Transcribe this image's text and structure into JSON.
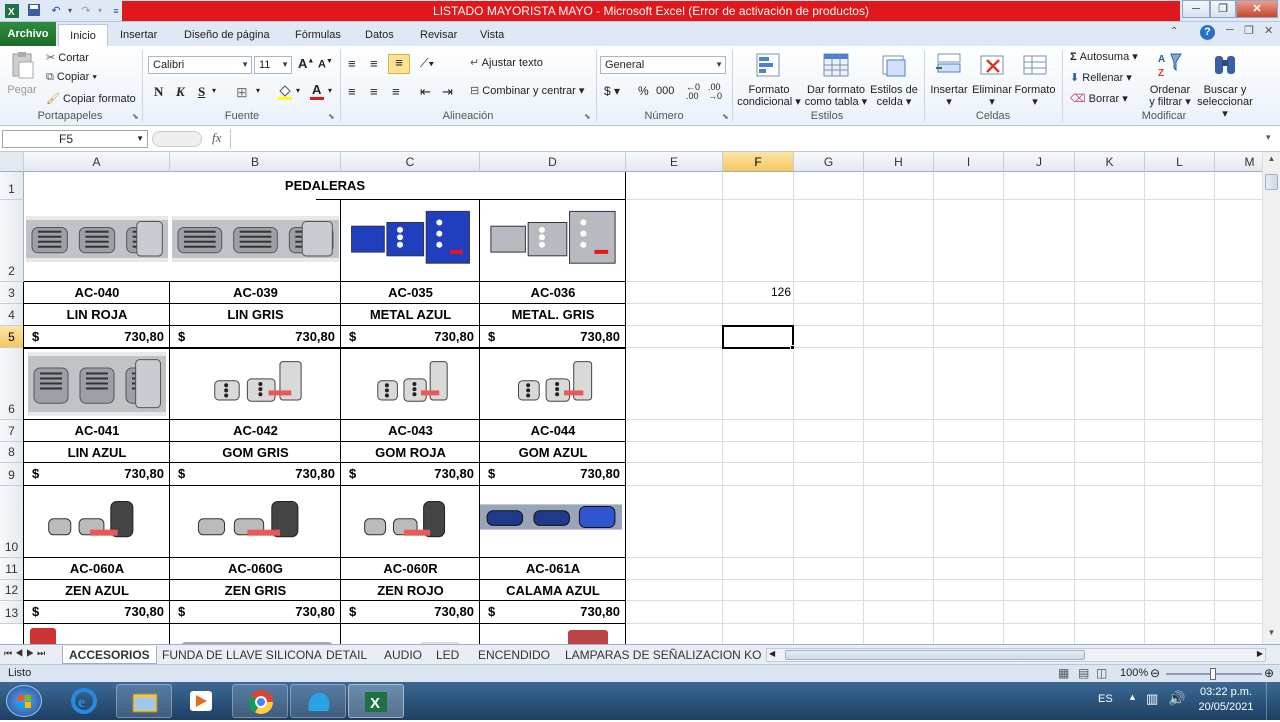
{
  "window": {
    "title": "LISTADO MAYORISTA MAYO  -  Microsoft Excel (Error de activación de productos)",
    "quick_access": [
      "save-icon",
      "undo-icon",
      "redo-icon"
    ]
  },
  "ribbon": {
    "tabs": [
      "Archivo",
      "Inicio",
      "Insertar",
      "Diseño de página",
      "Fórmulas",
      "Datos",
      "Revisar",
      "Vista"
    ],
    "clipboard": {
      "paste": "Pegar",
      "cut": "Cortar",
      "copy": "Copiar",
      "format_painter": "Copiar formato",
      "label": "Portapapeles"
    },
    "font": {
      "name": "Calibri",
      "size": "11",
      "bold": "N",
      "italic": "K",
      "underline": "S",
      "label": "Fuente"
    },
    "alignment": {
      "wrap": "Ajustar texto",
      "merge": "Combinar y centrar",
      "label": "Alineación"
    },
    "number": {
      "format": "General",
      "currency": "$",
      "percent": "%",
      "thousands": "000",
      "label": "Número"
    },
    "styles": {
      "conditional_1": "Formato",
      "conditional_2": "condicional",
      "table_1": "Dar formato",
      "table_2": "como tabla",
      "cell_1": "Estilos de",
      "cell_2": "celda",
      "label": "Estilos"
    },
    "cells": {
      "insert": "Insertar",
      "delete": "Eliminar",
      "format": "Formato",
      "label": "Celdas"
    },
    "editing": {
      "autosum": "Autosuma",
      "fill": "Rellenar",
      "clear": "Borrar",
      "sort_1": "Ordenar",
      "sort_2": "y filtrar",
      "find_1": "Buscar y",
      "find_2": "seleccionar",
      "label": "Modificar"
    }
  },
  "formula_bar": {
    "name_box": "F5",
    "fx": "fx",
    "value": ""
  },
  "columns": [
    "A",
    "B",
    "C",
    "D",
    "E",
    "F",
    "G",
    "H",
    "I",
    "J",
    "K",
    "L",
    "M"
  ],
  "rows": [
    "1",
    "2",
    "3",
    "4",
    "5",
    "6",
    "7",
    "8",
    "9",
    "10",
    "11",
    "12",
    "13"
  ],
  "selected_cell": "F5",
  "sheet": {
    "header": "PEDALERAS",
    "f3_value": "126",
    "currency": "$",
    "blocks": [
      {
        "codes": [
          "AC-040",
          "AC-039",
          "AC-035",
          "AC-036"
        ],
        "names": [
          "LIN ROJA",
          "LIN GRIS",
          "METAL AZUL",
          "METAL. GRIS"
        ],
        "prices": [
          "730,80",
          "730,80",
          "730,80",
          "730,80"
        ]
      },
      {
        "codes": [
          "AC-041",
          "AC-042",
          "AC-043",
          "AC-044"
        ],
        "names": [
          "LIN AZUL",
          "GOM GRIS",
          "GOM ROJA",
          "GOM AZUL"
        ],
        "prices": [
          "730,80",
          "730,80",
          "730,80",
          "730,80"
        ]
      },
      {
        "codes": [
          "AC-060A",
          "AC-060G",
          "AC-060R",
          "AC-061A"
        ],
        "names": [
          "ZEN AZUL",
          "ZEN GRIS",
          "ZEN ROJO",
          "CALAMA AZUL"
        ],
        "prices": [
          "730,80",
          "730,80",
          "730,80",
          "730,80"
        ]
      }
    ]
  },
  "sheet_tabs": [
    "ACCESORIOS",
    "FUNDA DE LLAVE SILICONA",
    "DETAIL",
    "AUDIO",
    "LED",
    "ENCENDIDO",
    "LAMPARAS DE SEÑALIZACION KOBO"
  ],
  "status": {
    "ready": "Listo",
    "zoom": "100%"
  },
  "taskbar": {
    "lang": "ES",
    "time": "03:22 p.m.",
    "date": "20/05/2021"
  },
  "colors": {
    "title_red": "#e0171b",
    "archivo_green": "#217346",
    "blue_pedal": "#1f3fbf"
  }
}
